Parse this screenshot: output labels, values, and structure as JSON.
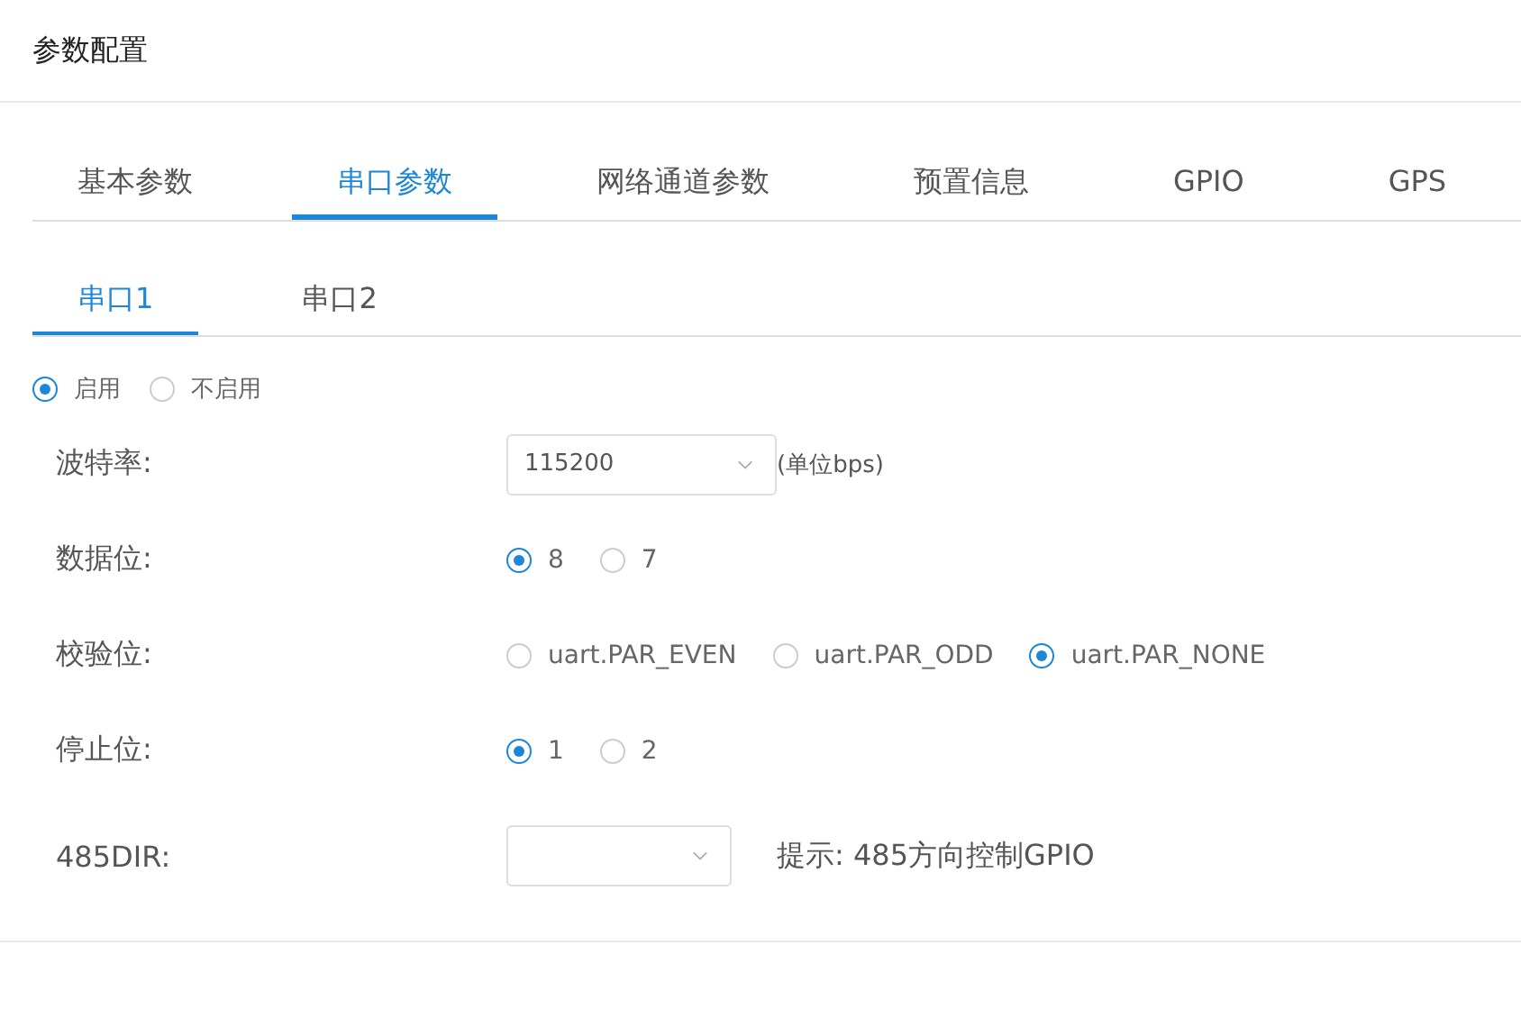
{
  "page_title": "参数配置",
  "tabs": [
    {
      "label": "基本参数",
      "selected": false
    },
    {
      "label": "串口参数",
      "selected": true
    },
    {
      "label": "网络通道参数",
      "selected": false
    },
    {
      "label": "预置信息",
      "selected": false
    },
    {
      "label": "GPIO",
      "selected": false
    },
    {
      "label": "GPS",
      "selected": false
    }
  ],
  "subtabs": [
    {
      "label": "串口1",
      "selected": true
    },
    {
      "label": "串口2",
      "selected": false
    }
  ],
  "enable_options": [
    {
      "label": "启用",
      "selected": true
    },
    {
      "label": "不启用",
      "selected": false
    }
  ],
  "fields": [
    {
      "kind": "select",
      "label": "波特率:",
      "value": "115200",
      "suffix": "(单位bps)"
    },
    {
      "kind": "radio",
      "label": "数据位:",
      "options": [
        {
          "label": "8",
          "selected": true
        },
        {
          "label": "7",
          "selected": false
        }
      ]
    },
    {
      "kind": "radio",
      "label": "校验位:",
      "options": [
        {
          "label": "uart.PAR_EVEN",
          "selected": false
        },
        {
          "label": "uart.PAR_ODD",
          "selected": false
        },
        {
          "label": "uart.PAR_NONE",
          "selected": true
        }
      ]
    },
    {
      "kind": "radio",
      "label": "停止位:",
      "options": [
        {
          "label": "1",
          "selected": true
        },
        {
          "label": "2",
          "selected": false
        }
      ]
    },
    {
      "kind": "select",
      "label": "485DIR:",
      "hint": "提示: 485方向控制GPIO"
    }
  ]
}
